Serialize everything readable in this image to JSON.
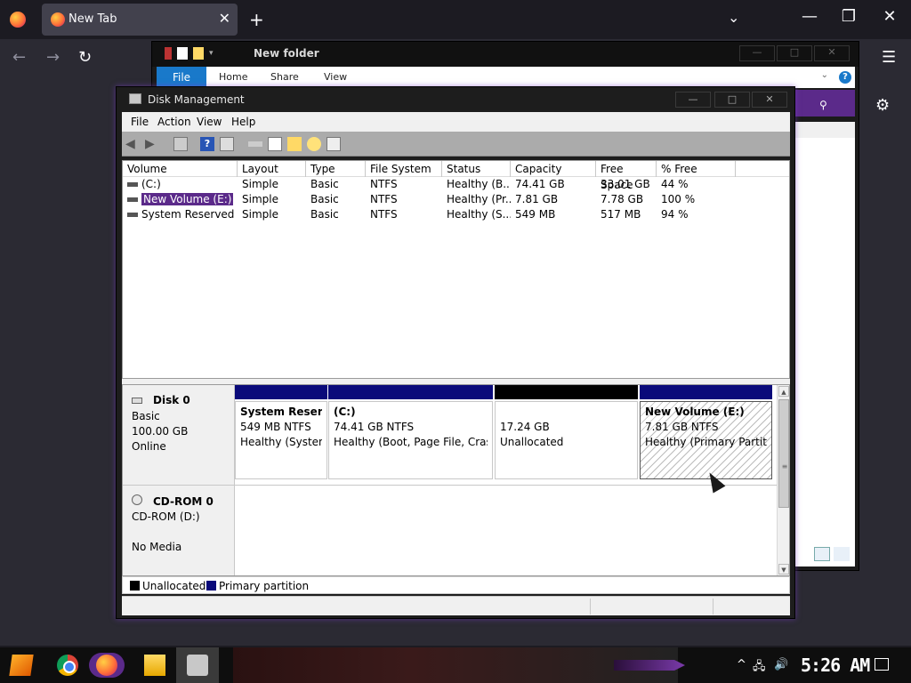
{
  "firefox": {
    "tab_title": "New Tab",
    "tab_close": "✕",
    "new_tab": "+",
    "tab_list": "⌄",
    "minimize": "—",
    "restore": "❐",
    "close": "✕",
    "back": "←",
    "forward": "→",
    "reload": "↻",
    "menu": "☰",
    "settings": "⚙"
  },
  "explorer": {
    "title": "New folder",
    "ribbon_tabs": [
      "File",
      "Home",
      "Share",
      "View"
    ],
    "help": "?",
    "chevron": "⌄",
    "search_icon": "⚲",
    "minimize": "—",
    "maximize": "□",
    "close": "✕"
  },
  "disk_management": {
    "title": "Disk Management",
    "minimize": "—",
    "maximize": "□",
    "close": "✕",
    "menu": [
      "File",
      "Action",
      "View",
      "Help"
    ],
    "volume_columns": [
      "Volume",
      "Layout",
      "Type",
      "File System",
      "Status",
      "Capacity",
      "Free Space",
      "% Free"
    ],
    "volumes": [
      {
        "volume": "(C:)",
        "layout": "Simple",
        "type": "Basic",
        "fs": "NTFS",
        "status": "Healthy (B...",
        "capacity": "74.41 GB",
        "free": "33.01 GB",
        "pct": "44 %"
      },
      {
        "volume": "New Volume (E:)",
        "layout": "Simple",
        "type": "Basic",
        "fs": "NTFS",
        "status": "Healthy (Pr...",
        "capacity": "7.81 GB",
        "free": "7.78 GB",
        "pct": "100 %"
      },
      {
        "volume": "System Reserved",
        "layout": "Simple",
        "type": "Basic",
        "fs": "NTFS",
        "status": "Healthy (S...",
        "capacity": "549 MB",
        "free": "517 MB",
        "pct": "94 %"
      }
    ],
    "disks": [
      {
        "name": "Disk 0",
        "type": "Basic",
        "size": "100.00 GB",
        "state": "Online"
      },
      {
        "name": "CD-ROM 0",
        "type": "CD-ROM (D:)",
        "state": "No Media"
      }
    ],
    "partitions": [
      {
        "name": "System Reserv",
        "size": "549 MB NTFS",
        "status": "Healthy (Systen",
        "bar": "#0a0a7a"
      },
      {
        "name": "(C:)",
        "size": "74.41 GB NTFS",
        "status": "Healthy (Boot, Page File, Crash",
        "bar": "#0a0a7a"
      },
      {
        "name": "",
        "size": "17.24 GB",
        "status": "Unallocated",
        "bar": "#000000"
      },
      {
        "name": "New Volume  (E:)",
        "size": "7.81 GB NTFS",
        "status": "Healthy (Primary Partiti",
        "bar": "#0a0a7a"
      }
    ],
    "legend": [
      {
        "label": "Unallocated",
        "color": "#000000"
      },
      {
        "label": "Primary partition",
        "color": "#0a0a7a"
      }
    ],
    "scroll_up": "▲",
    "scroll_grip": "≡",
    "scroll_down": "▼"
  },
  "taskbar": {
    "clock": "5:26 AM",
    "tray_chevron": "^",
    "tray_network": "🖧",
    "tray_volume": "🔊"
  },
  "colors": {
    "accent_purple": "#5b2a8a",
    "primary_partition": "#0a0a7a"
  }
}
